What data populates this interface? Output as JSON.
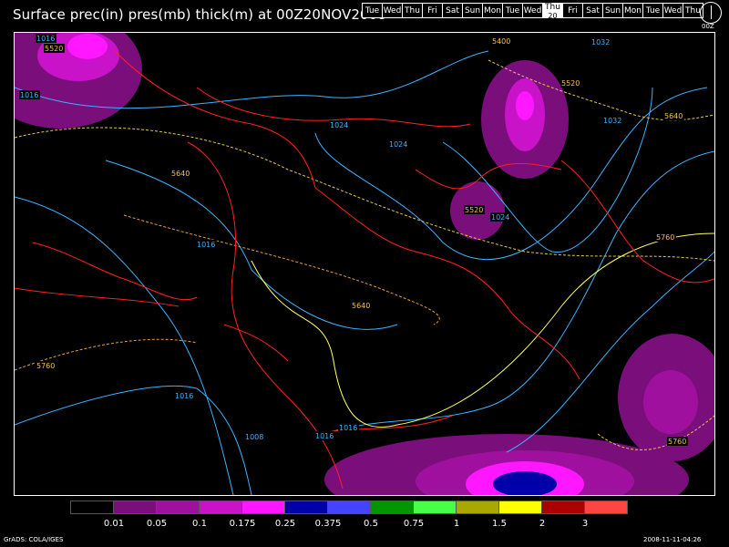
{
  "title": "Surface prec(in) pres(mb) thick(m) at 00Z20NOV2008",
  "days": [
    "Tue",
    "Wed",
    "Thu",
    "Fri",
    "Sat",
    "Sun",
    "Mon",
    "Tue",
    "Wed",
    "Thu",
    "Fri",
    "Sat",
    "Sun",
    "Mon",
    "Tue",
    "Wed",
    "Thu"
  ],
  "selected_day": {
    "label": "Thu",
    "number": "20"
  },
  "clock_label": "00Z",
  "legend": {
    "colors": [
      "#000000",
      "#7a0e7a",
      "#a0109f",
      "#c813c8",
      "#ff17ff",
      "#0000a8",
      "#4444ff",
      "#009600",
      "#47ff47",
      "#a8a800",
      "#ffff00",
      "#aa0000",
      "#ff4444"
    ],
    "labels": [
      "0.01",
      "0.05",
      "0.1",
      "0.175",
      "0.25",
      "0.375",
      "0.5",
      "0.75",
      "1",
      "1.5",
      "2",
      "3"
    ]
  },
  "contour_labels": {
    "pressure": [
      "1016",
      "1016",
      "1024",
      "1024",
      "1024",
      "1032",
      "1032",
      "1016",
      "1016",
      "1008",
      "1016",
      "1016"
    ],
    "thickness": [
      "5520",
      "5400",
      "5520",
      "5640",
      "5640",
      "5520",
      "5640",
      "5760",
      "5760",
      "5760"
    ]
  },
  "footer_left": "GrADS: COLA/IGES",
  "footer_right": "2008-11-11-04:26"
}
